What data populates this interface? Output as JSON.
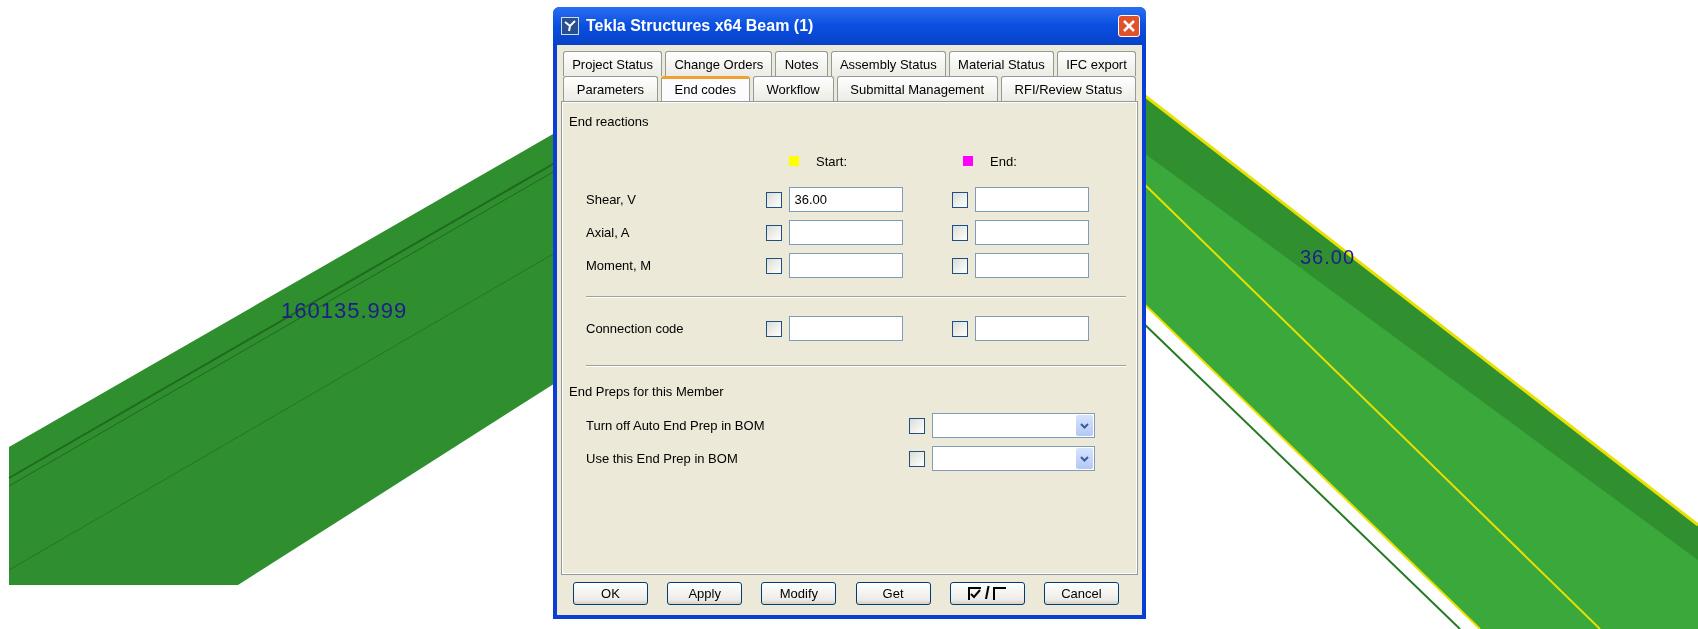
{
  "window": {
    "title": "Tekla Structures x64  Beam (1)"
  },
  "canvas": {
    "labels": [
      {
        "text": "160135.999"
      },
      {
        "text": "36.00"
      }
    ]
  },
  "tab_rows": [
    {
      "tabs": [
        {
          "label": "Project Status",
          "selected": false
        },
        {
          "label": "Change Orders",
          "selected": false
        },
        {
          "label": "Notes",
          "selected": false
        },
        {
          "label": "Assembly Status",
          "selected": false
        },
        {
          "label": "Material Status",
          "selected": false
        },
        {
          "label": "IFC export",
          "selected": false
        }
      ]
    },
    {
      "tabs": [
        {
          "label": "Parameters",
          "selected": false
        },
        {
          "label": "End codes",
          "selected": true
        },
        {
          "label": "Workflow",
          "selected": false
        },
        {
          "label": "Submittal Management",
          "selected": false
        },
        {
          "label": "RFI/Review Status",
          "selected": false
        }
      ]
    }
  ],
  "end_reactions": {
    "title": "End reactions",
    "columns": [
      {
        "label": "Start:",
        "color": "#ffff00"
      },
      {
        "label": "End:",
        "color": "#ff00ff"
      }
    ],
    "rows": [
      {
        "label": "Shear, V",
        "cells": [
          {
            "checked": false,
            "value": "36.00"
          },
          {
            "checked": false
          }
        ]
      },
      {
        "label": "Axial, A",
        "cells": [
          {
            "checked": false
          },
          {
            "checked": false
          }
        ]
      },
      {
        "label": "Moment, M",
        "cells": [
          {
            "checked": false
          },
          {
            "checked": false
          }
        ]
      }
    ]
  },
  "connection": {
    "label": "Connection code",
    "cells": [
      {
        "checked": false
      },
      {
        "checked": false
      }
    ]
  },
  "end_preps": {
    "title": "End Preps for this Member",
    "rows": [
      {
        "label": "Turn off Auto End Prep in BOM",
        "checked": false
      },
      {
        "label": "Use this End Prep in BOM",
        "checked": false
      }
    ]
  },
  "buttons": [
    {
      "kind": "text",
      "label": "OK"
    },
    {
      "kind": "text",
      "label": "Apply"
    },
    {
      "kind": "text",
      "label": "Modify"
    },
    {
      "kind": "text",
      "label": "Get"
    },
    {
      "kind": "toggle",
      "label": "/"
    },
    {
      "kind": "text",
      "label": "Cancel"
    }
  ]
}
